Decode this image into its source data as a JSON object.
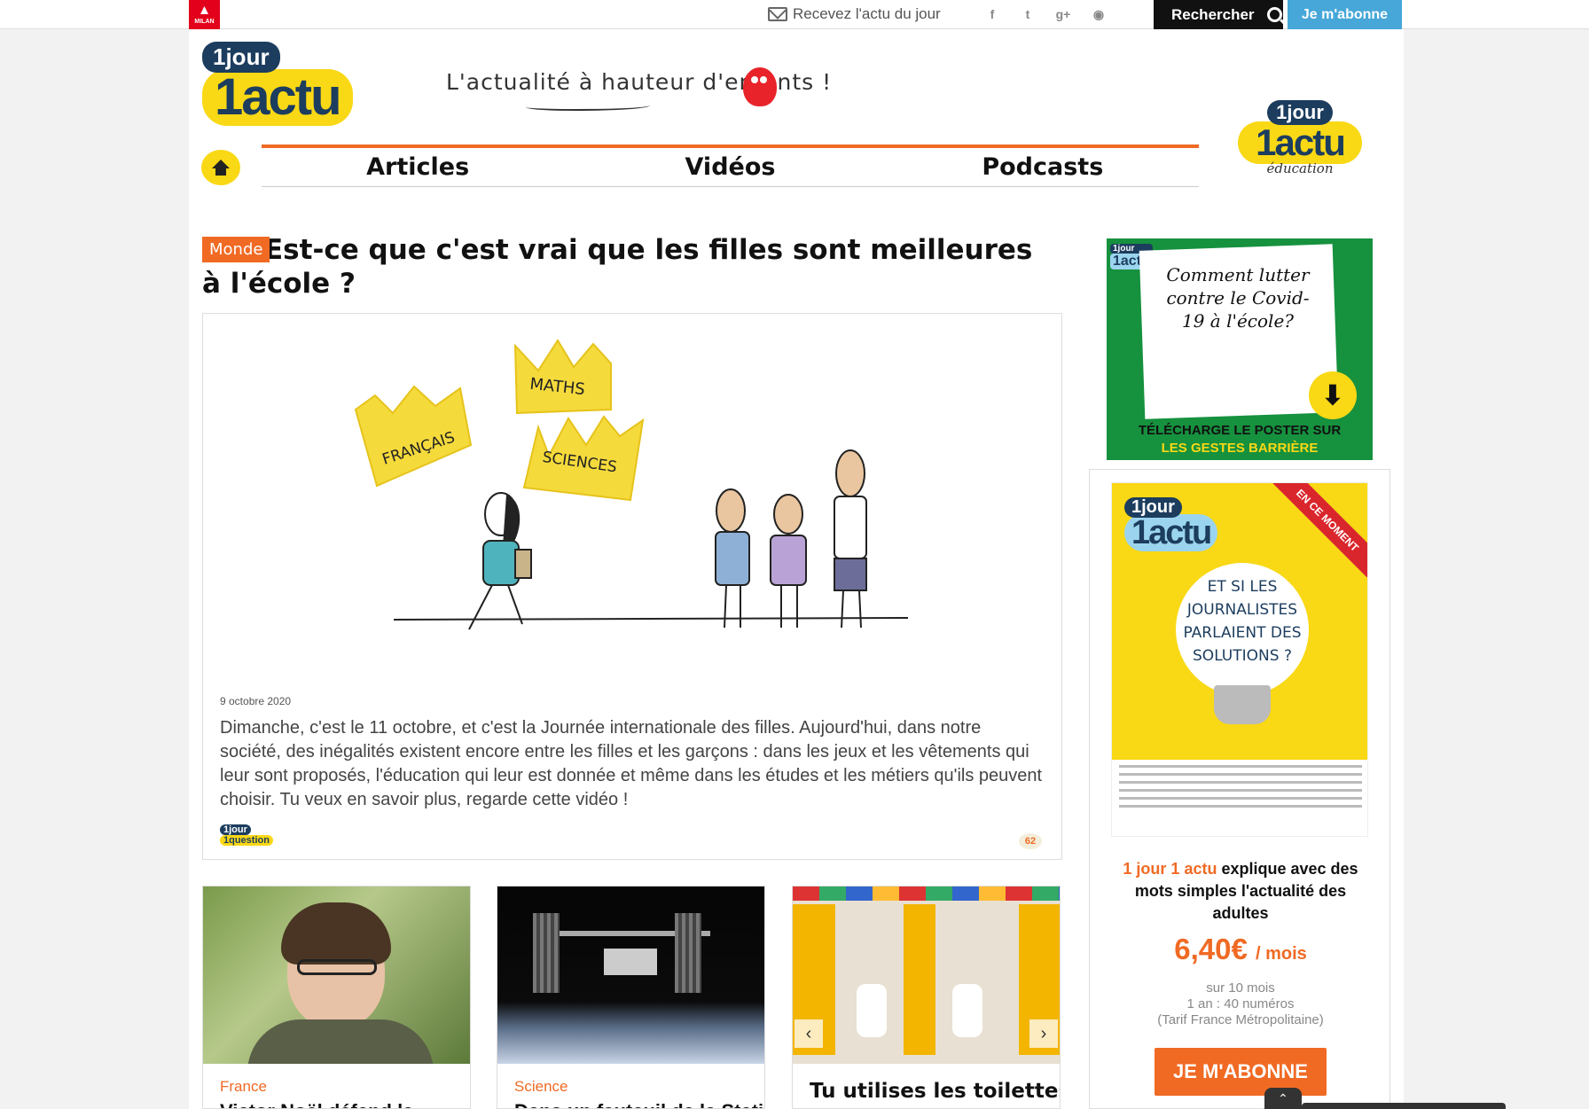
{
  "topbar": {
    "milan_label": "MILAN",
    "newsletter_label": "Recevez l'actu du jour",
    "socials": [
      "f",
      "t",
      "g+",
      "rss"
    ],
    "search_label": "Rechercher",
    "subscribe_label": "Je m'abonne"
  },
  "header": {
    "logo_line1": "1jour",
    "logo_line2": "1actu",
    "tagline": "L'actualité à hauteur d'enfants !",
    "edu_line1": "1jour",
    "edu_line2": "1actu",
    "edu_sub": "éducation"
  },
  "nav": {
    "items": [
      "Articles",
      "Vidéos",
      "Podcasts"
    ]
  },
  "article": {
    "category": "Monde",
    "title": "Est-ce que c'est vrai que les filles sont meilleures à l'école ?",
    "date": "9 octobre 2020",
    "description": "Dimanche, c'est le 11 octobre, et c'est la Journée internationale des filles. Aujourd'hui, dans notre société, des inégalités existent encore entre les filles et les garçons : dans les jeux et les vêtements qui leur sont proposés, l'éducation qui leur est donnée et même dans les études et les métiers qu'ils peuvent choisir. Tu veux en savoir plus, regarde cette vidéo !",
    "badge_line1": "1jour",
    "badge_line2": "1question",
    "comments": "62",
    "illustration_crowns": [
      "FRANÇAIS",
      "MATHS",
      "SCIENCES"
    ]
  },
  "thumbnails": [
    {
      "category": "France",
      "title": "Victor Noël défend la"
    },
    {
      "category": "Science",
      "title": "Dans un fauteuil de la Station"
    },
    {
      "category": "",
      "title": "Tu utilises les toilettes"
    }
  ],
  "sidebar": {
    "poster_logo1": "1jour",
    "poster_logo2": "1actu",
    "poster_text": "Comment lutter contre le Covid-19 à l'école?",
    "poster_cta1": "TÉLÉCHARGE LE POSTER SUR",
    "poster_cta2": "LES GESTES BARRIÈRE",
    "ribbon": "EN CE MOMENT",
    "cover_logo1": "1jour",
    "cover_logo2": "1actu",
    "cover_text": "ET SI LES JOURNALISTES PARLAIENT DES SOLUTIONS ?",
    "mag_brand": "1 jour 1 actu",
    "mag_desc": "explique avec des mots simples l'actualité des adultes",
    "price": "6,40€",
    "price_unit": "/ mois",
    "price_note1": "sur 10 mois",
    "price_note2": "1 an : 40 numéros",
    "price_note3": "(Tarif France Métropolitaine)",
    "subscribe_label": "JE M'ABONNE"
  },
  "colors": {
    "orange": "#f06a24",
    "yellow": "#f9d815",
    "navy": "#1c3d5e",
    "blue": "#46a7d8",
    "green": "#16913e"
  }
}
